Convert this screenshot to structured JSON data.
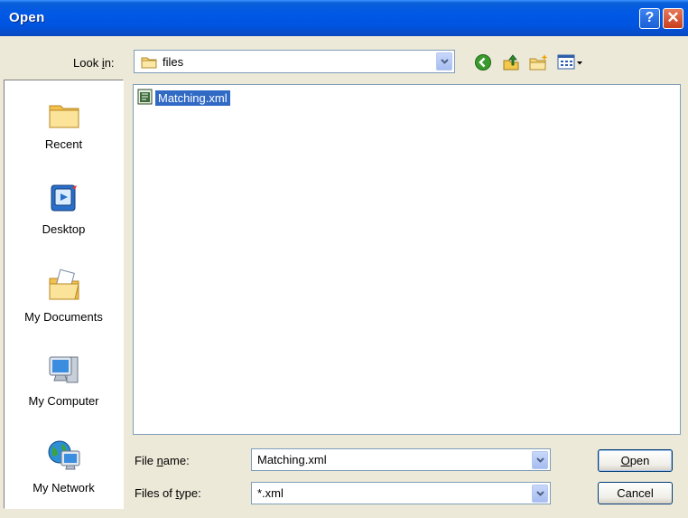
{
  "window": {
    "title": "Open"
  },
  "title_buttons": {
    "help": "?",
    "close": "✕"
  },
  "lookin": {
    "label_pre": "Look ",
    "label_u": "i",
    "label_post": "n:",
    "value": "files"
  },
  "toolbar": {
    "icons": [
      "back-icon",
      "up-folder-icon",
      "new-folder-icon",
      "view-menu-icon"
    ]
  },
  "places": [
    {
      "label": "Recent",
      "icon": "recent-folder-icon"
    },
    {
      "label": "Desktop",
      "icon": "desktop-icon"
    },
    {
      "label": "My Documents",
      "icon": "my-documents-icon"
    },
    {
      "label": "My Computer",
      "icon": "my-computer-icon"
    },
    {
      "label": "My Network",
      "icon": "my-network-icon"
    }
  ],
  "files": [
    {
      "name": "Matching.xml",
      "icon": "xml-file-icon",
      "selected": true
    }
  ],
  "filename": {
    "label_pre": "File ",
    "label_u": "n",
    "label_post": "ame:",
    "value": "Matching.xml"
  },
  "filetype": {
    "label_pre": "Files of ",
    "label_u": "t",
    "label_post": "ype:",
    "value": "*.xml"
  },
  "buttons": {
    "open_u": "O",
    "open_rest": "pen",
    "cancel": "Cancel"
  },
  "colors": {
    "titlebar": "#0058e6",
    "selection": "#316ac5",
    "dialog_bg": "#ece9d8"
  }
}
